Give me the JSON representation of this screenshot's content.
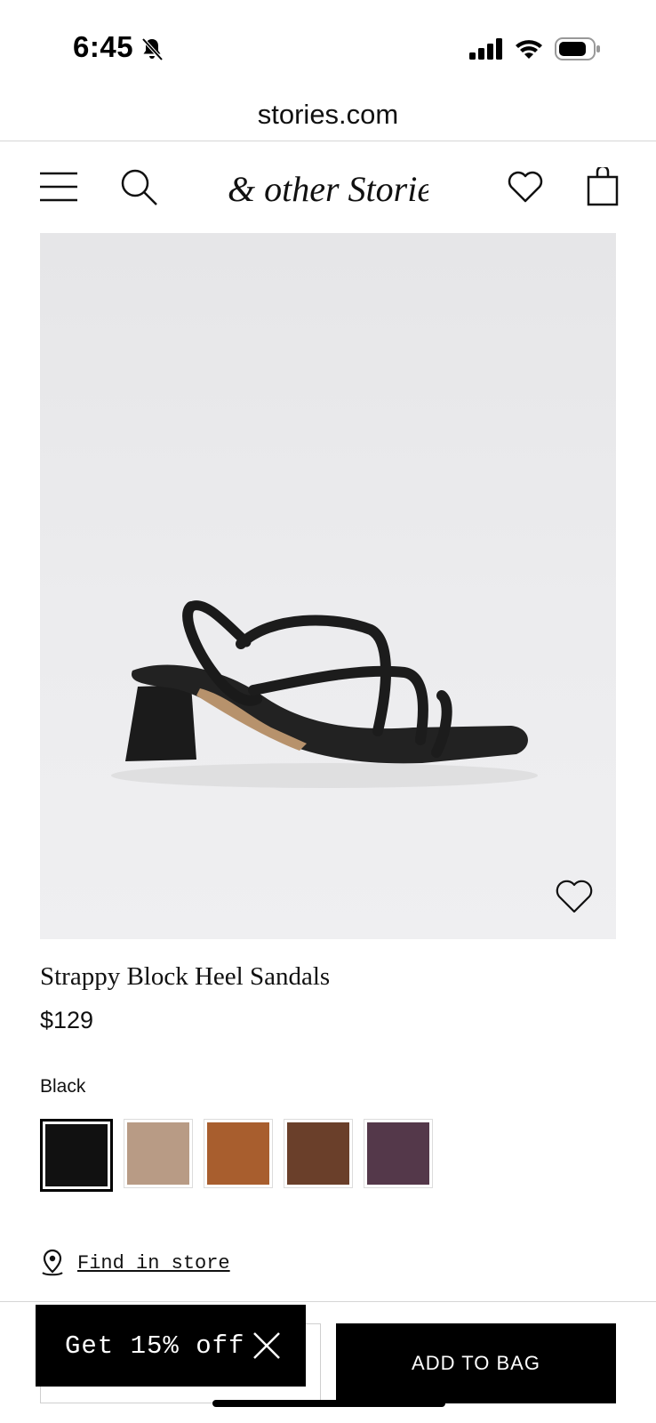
{
  "status_bar": {
    "time": "6:45",
    "icons": [
      "bell-slash-icon",
      "signal-icon",
      "wifi-icon",
      "battery-icon"
    ]
  },
  "browser": {
    "url": "stories.com"
  },
  "header": {
    "logo": "& other Stories",
    "icons": [
      "menu-icon",
      "search-icon",
      "heart-icon",
      "shopping-bag-icon"
    ]
  },
  "product": {
    "title": "Strappy Block Heel Sandals",
    "price": "$129",
    "selected_color": "Black",
    "swatches": [
      {
        "color": "#111111",
        "selected": true
      },
      {
        "color": "#b89b85",
        "selected": false
      },
      {
        "color": "#a85e2e",
        "selected": false
      },
      {
        "color": "#6a3f2a",
        "selected": false
      },
      {
        "color": "#54384a",
        "selected": false
      }
    ]
  },
  "store": {
    "find_in_store_label": "Find in store"
  },
  "actions": {
    "add_to_bag_label": "ADD TO BAG"
  },
  "promo": {
    "label": "Get 15% off"
  }
}
